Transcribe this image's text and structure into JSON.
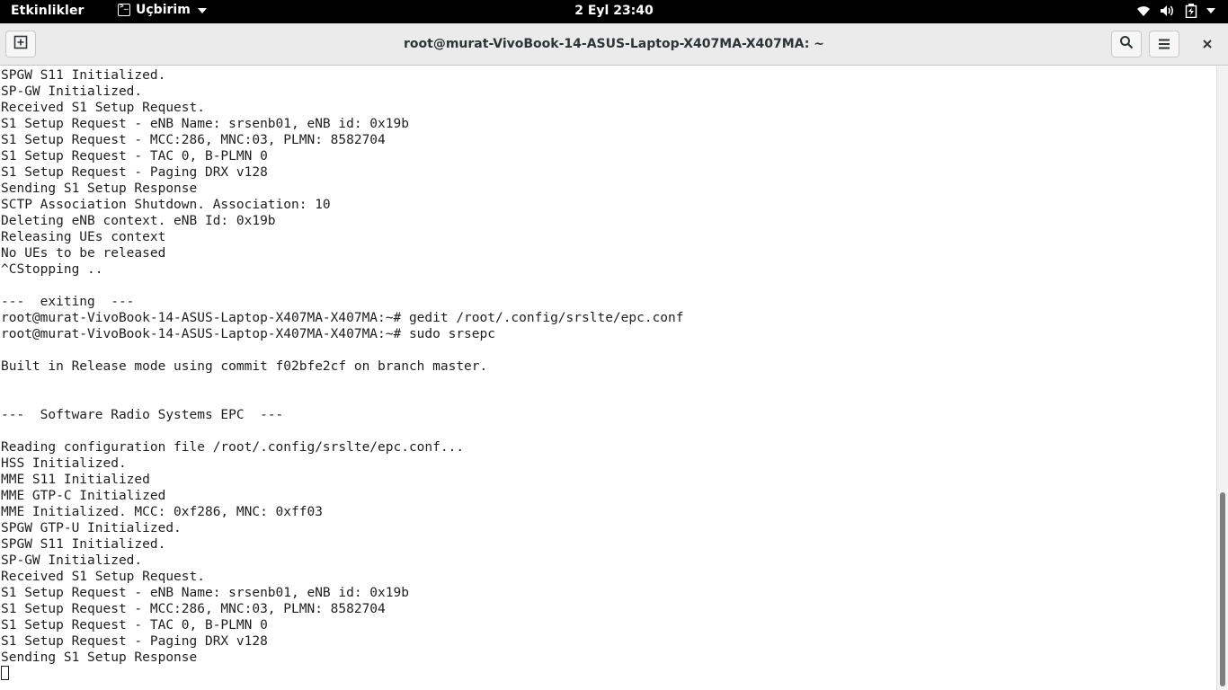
{
  "topbar": {
    "activities": "Etkinlikler",
    "app_menu": "Uçbirim",
    "clock": "2 Eyl 23:40",
    "tray_icons": [
      "wifi-icon",
      "volume-icon",
      "battery-icon",
      "system-menu-caret-icon"
    ]
  },
  "window": {
    "title": "root@murat-VivoBook-14-ASUS-Laptop-X407MA-X407MA: ~",
    "buttons": [
      "new-tab-icon",
      "search-icon",
      "hamburger-menu-icon",
      "close-icon"
    ]
  },
  "terminal": {
    "lines": [
      "SPGW S11 Initialized.",
      "SP-GW Initialized.",
      "Received S1 Setup Request.",
      "S1 Setup Request - eNB Name: srsenb01, eNB id: 0x19b",
      "S1 Setup Request - MCC:286, MNC:03, PLMN: 8582704",
      "S1 Setup Request - TAC 0, B-PLMN 0",
      "S1 Setup Request - Paging DRX v128",
      "Sending S1 Setup Response",
      "SCTP Association Shutdown. Association: 10",
      "Deleting eNB context. eNB Id: 0x19b",
      "Releasing UEs context",
      "No UEs to be released",
      "^CStopping ..",
      "",
      "---  exiting  ---",
      "root@murat-VivoBook-14-ASUS-Laptop-X407MA-X407MA:~# gedit /root/.config/srslte/epc.conf",
      "root@murat-VivoBook-14-ASUS-Laptop-X407MA-X407MA:~# sudo srsepc",
      "",
      "Built in Release mode using commit f02bfe2cf on branch master.",
      "",
      "",
      "---  Software Radio Systems EPC  ---",
      "",
      "Reading configuration file /root/.config/srslte/epc.conf...",
      "HSS Initialized.",
      "MME S11 Initialized",
      "MME GTP-C Initialized",
      "MME Initialized. MCC: 0xf286, MNC: 0xff03",
      "SPGW GTP-U Initialized.",
      "SPGW S11 Initialized.",
      "SP-GW Initialized.",
      "Received S1 Setup Request.",
      "S1 Setup Request - eNB Name: srsenb01, eNB id: 0x19b",
      "S1 Setup Request - MCC:286, MNC:03, PLMN: 8582704",
      "S1 Setup Request - TAC 0, B-PLMN 0",
      "S1 Setup Request - Paging DRX v128",
      "Sending S1 Setup Response",
      ""
    ],
    "scroll_position": 0.97
  }
}
